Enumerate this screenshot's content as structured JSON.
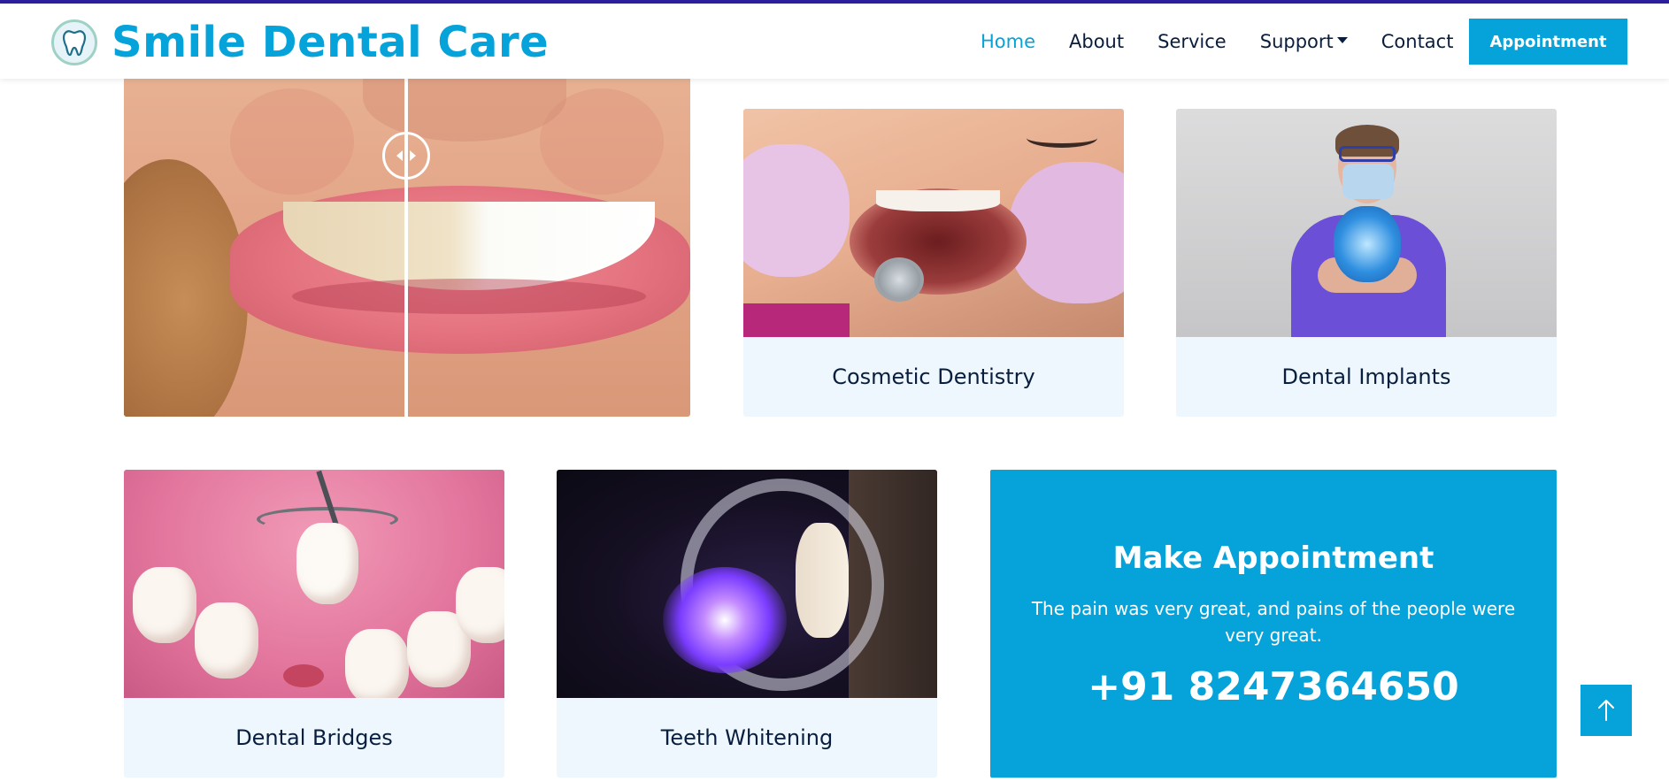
{
  "brand": {
    "title": "Smile Dental Care",
    "logo_icon": "tooth-icon"
  },
  "nav": {
    "items": [
      {
        "label": "Home",
        "active": true
      },
      {
        "label": "About",
        "active": false
      },
      {
        "label": "Service",
        "active": false
      },
      {
        "label": "Support",
        "active": false,
        "has_dropdown": true
      },
      {
        "label": "Contact",
        "active": false
      }
    ],
    "cta_label": "Appointment"
  },
  "hero": {
    "type": "before-after-comparison",
    "handle_icon": "left-right-arrows-icon"
  },
  "services": [
    {
      "label": "Cosmetic Dentistry"
    },
    {
      "label": "Dental Implants"
    },
    {
      "label": "Dental Bridges"
    },
    {
      "label": "Teeth Whitening"
    }
  ],
  "appointment": {
    "title": "Make Appointment",
    "description": "The pain was very great, and pains of the people were very great.",
    "phone": "+91 8247364650"
  },
  "back_to_top_icon": "arrow-up-icon",
  "colors": {
    "accent": "#06a3da",
    "text_dark": "#091e3e",
    "card_bg": "#eef7fd",
    "top_border": "#2b1f9e"
  }
}
